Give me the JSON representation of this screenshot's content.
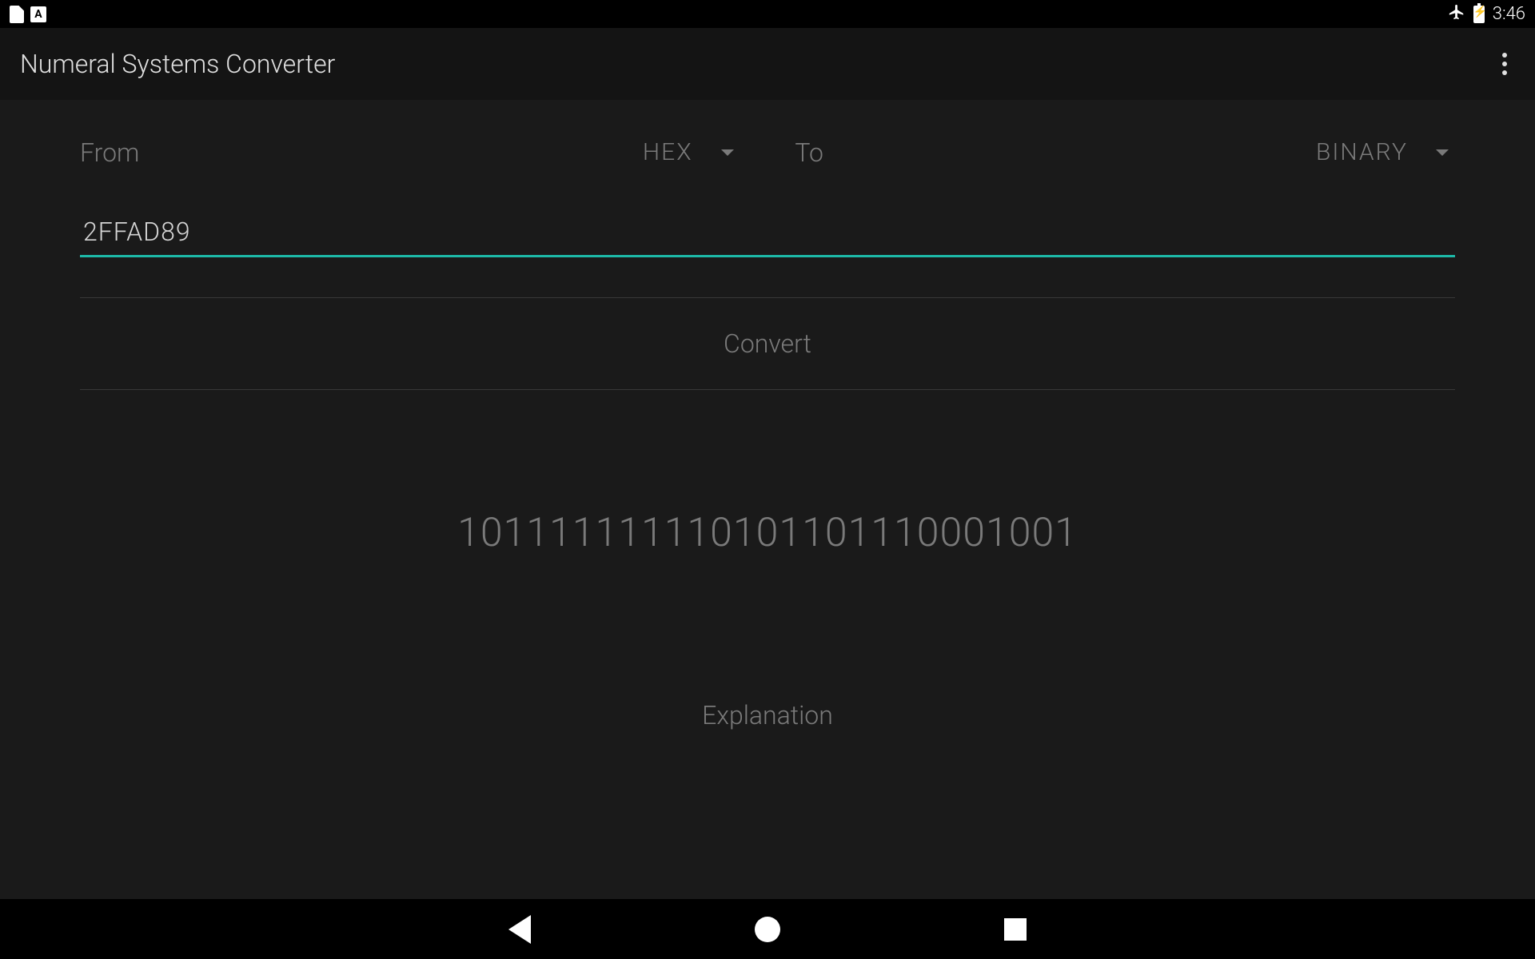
{
  "statusBar": {
    "aIcon": "A",
    "time": "3:46"
  },
  "appBar": {
    "title": "Numeral Systems Converter"
  },
  "converter": {
    "fromLabel": "From",
    "fromValue": "HEX",
    "toLabel": "To",
    "toValue": "BINARY",
    "inputValue": "2FFAD89",
    "convertLabel": "Convert",
    "resultValue": "101111111110101101110001001",
    "explanationLabel": "Explanation"
  }
}
